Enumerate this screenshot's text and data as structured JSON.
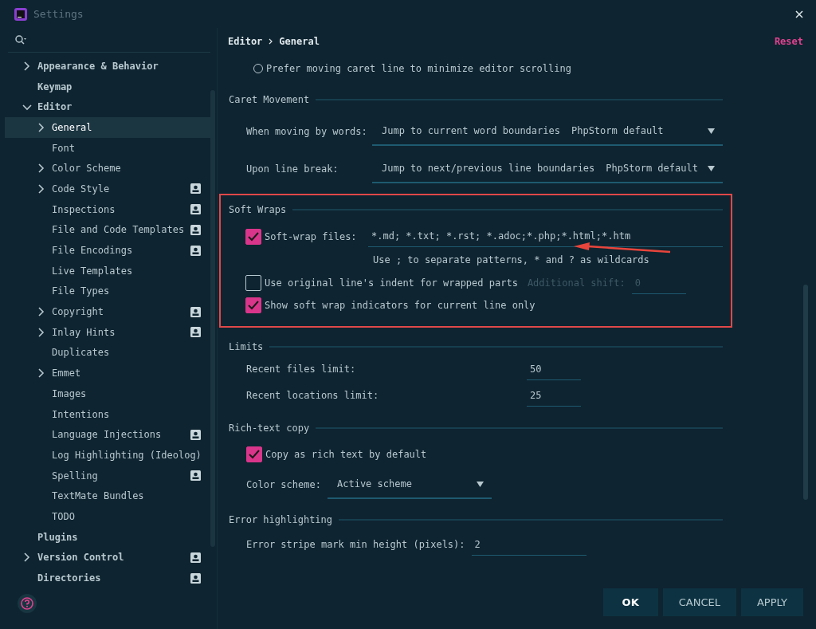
{
  "window": {
    "title": "Settings"
  },
  "sidebar": {
    "items": [
      {
        "label": "Appearance & Behavior",
        "expanded": false,
        "selected": false,
        "shared": false
      },
      {
        "label": "Keymap",
        "selected": false,
        "shared": false
      },
      {
        "label": "Editor",
        "expanded": true,
        "selected": false,
        "shared": false,
        "children": [
          {
            "label": "General",
            "expanded": false,
            "selected": true,
            "shared": false
          },
          {
            "label": "Font",
            "selected": false,
            "shared": false
          },
          {
            "label": "Color Scheme",
            "expanded": false,
            "selected": false,
            "shared": false
          },
          {
            "label": "Code Style",
            "expanded": false,
            "selected": false,
            "shared": true
          },
          {
            "label": "Inspections",
            "selected": false,
            "shared": true
          },
          {
            "label": "File and Code Templates",
            "selected": false,
            "shared": true
          },
          {
            "label": "File Encodings",
            "selected": false,
            "shared": true
          },
          {
            "label": "Live Templates",
            "selected": false,
            "shared": false
          },
          {
            "label": "File Types",
            "selected": false,
            "shared": false
          },
          {
            "label": "Copyright",
            "expanded": false,
            "selected": false,
            "shared": true
          },
          {
            "label": "Inlay Hints",
            "expanded": false,
            "selected": false,
            "shared": true
          },
          {
            "label": "Duplicates",
            "selected": false,
            "shared": false
          },
          {
            "label": "Emmet",
            "expanded": false,
            "selected": false,
            "shared": false
          },
          {
            "label": "Images",
            "selected": false,
            "shared": false
          },
          {
            "label": "Intentions",
            "selected": false,
            "shared": false
          },
          {
            "label": "Language Injections",
            "selected": false,
            "shared": true
          },
          {
            "label": "Log Highlighting (Ideolog)",
            "selected": false,
            "shared": false
          },
          {
            "label": "Spelling",
            "selected": false,
            "shared": true
          },
          {
            "label": "TextMate Bundles",
            "selected": false,
            "shared": false
          },
          {
            "label": "TODO",
            "selected": false,
            "shared": false
          }
        ]
      },
      {
        "label": "Plugins",
        "selected": false,
        "shared": false
      },
      {
        "label": "Version Control",
        "expanded": false,
        "selected": false,
        "shared": true
      },
      {
        "label": "Directories",
        "selected": false,
        "shared": true
      }
    ]
  },
  "breadcrumb": [
    "Editor",
    "General"
  ],
  "reset": "Reset",
  "top_rows": [
    {
      "kind": "radio",
      "label": "Prefer moving caret line to minimize editor scrolling",
      "selected": false
    }
  ],
  "sections": [
    {
      "title": "Caret Movement",
      "highlighted": false,
      "rows": [
        {
          "kind": "select",
          "label": "When moving by words:",
          "value": "Jump to current word boundaries",
          "note": "PhpStorm default"
        },
        {
          "kind": "select",
          "label": "Upon line break:",
          "value": "Jump to next/previous line boundaries",
          "note": "PhpStorm default"
        }
      ]
    },
    {
      "title": "Soft Wraps",
      "highlighted": true,
      "rows": [
        {
          "kind": "checkfield",
          "label": "Soft-wrap files:",
          "checked": true,
          "value": "*.md; *.txt; *.rst; *.adoc;*.php;*.html;*.htm",
          "hint": "Use ; to separate patterns, * and ? as wildcards"
        },
        {
          "kind": "checkbox",
          "label": "Use original line's indent for wrapped parts",
          "checked": false,
          "extra_label": "Additional shift:",
          "extra_value": "0",
          "extra_disabled": true
        },
        {
          "kind": "checkbox",
          "label": "Show soft wrap indicators for current line only",
          "checked": true
        }
      ]
    },
    {
      "title": "Limits",
      "highlighted": false,
      "rows": [
        {
          "kind": "field",
          "label": "Recent files limit:",
          "value": "50"
        },
        {
          "kind": "field",
          "label": "Recent locations limit:",
          "value": "25"
        }
      ]
    },
    {
      "title": "Rich-text copy",
      "highlighted": false,
      "rows": [
        {
          "kind": "checkbox",
          "label": "Copy as rich text by default",
          "checked": true
        },
        {
          "kind": "select",
          "label": "Color scheme:",
          "value": "Active scheme"
        }
      ]
    },
    {
      "title": "Error highlighting",
      "highlighted": false,
      "rows": [
        {
          "kind": "field",
          "label": "Error stripe mark min height (pixels):",
          "value": "2"
        }
      ]
    }
  ],
  "buttons": [
    {
      "label": "OK",
      "default": true
    },
    {
      "label": "CANCEL",
      "default": false
    },
    {
      "label": "APPLY",
      "default": false
    }
  ]
}
